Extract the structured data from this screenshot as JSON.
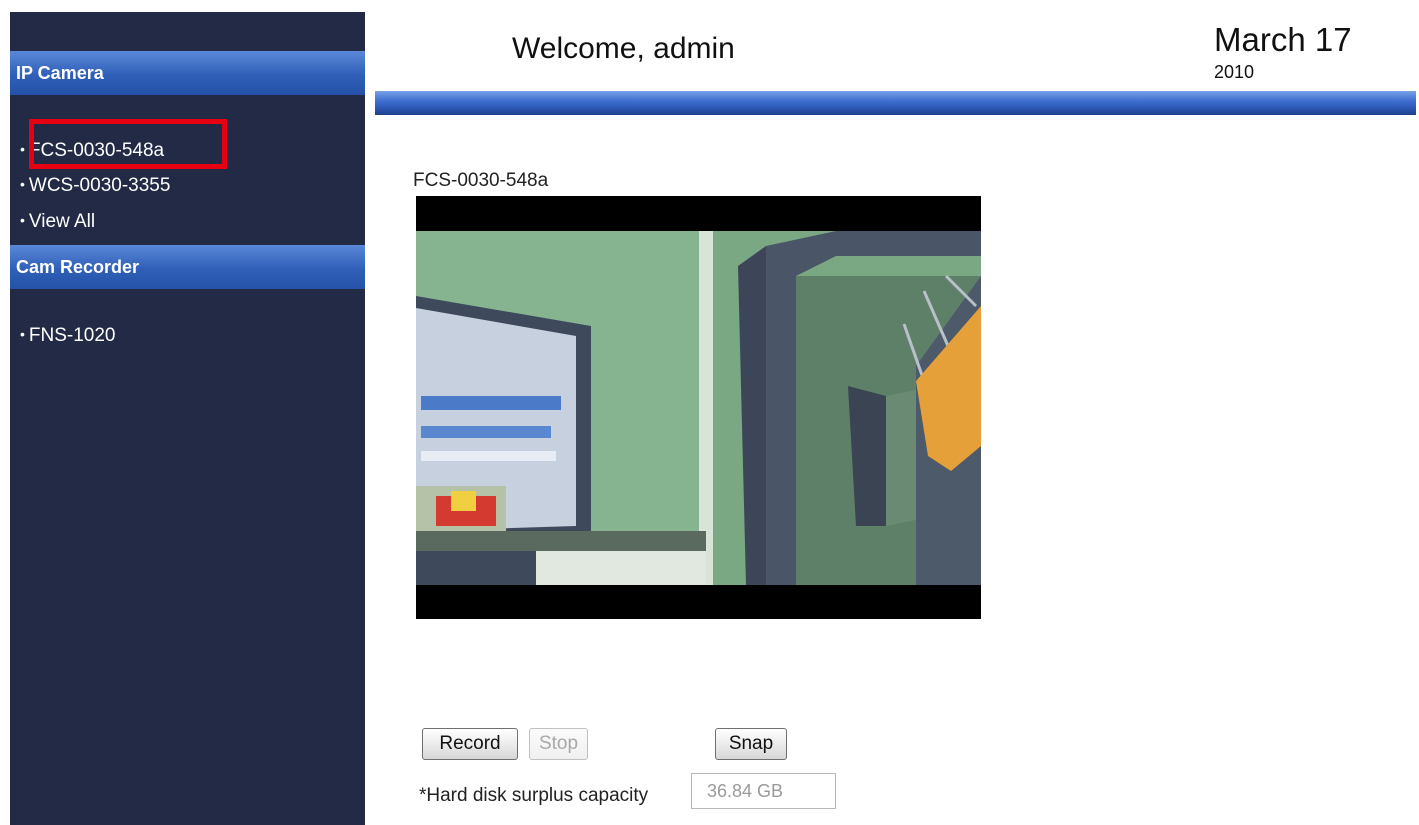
{
  "sidebar": {
    "sections": [
      {
        "title": "IP Camera",
        "items": [
          "FCS-0030-548a",
          "WCS-0030-3355",
          "View All"
        ]
      },
      {
        "title": "Cam Recorder",
        "items": [
          "FNS-1020"
        ]
      }
    ]
  },
  "header": {
    "welcome": "Welcome, admin",
    "date_month_day": "March 17",
    "date_year": "2010"
  },
  "main": {
    "camera_title": "FCS-0030-548a",
    "buttons": {
      "record": "Record",
      "stop": "Stop",
      "snap": "Snap"
    },
    "capacity_label": "*Hard disk surplus capacity",
    "capacity_value": "36.84  GB"
  },
  "colors": {
    "sidebar_bg": "#222a45",
    "section_header": "#2f5fb8",
    "highlight": "#e50012",
    "header_bar": "#3f70d0"
  }
}
